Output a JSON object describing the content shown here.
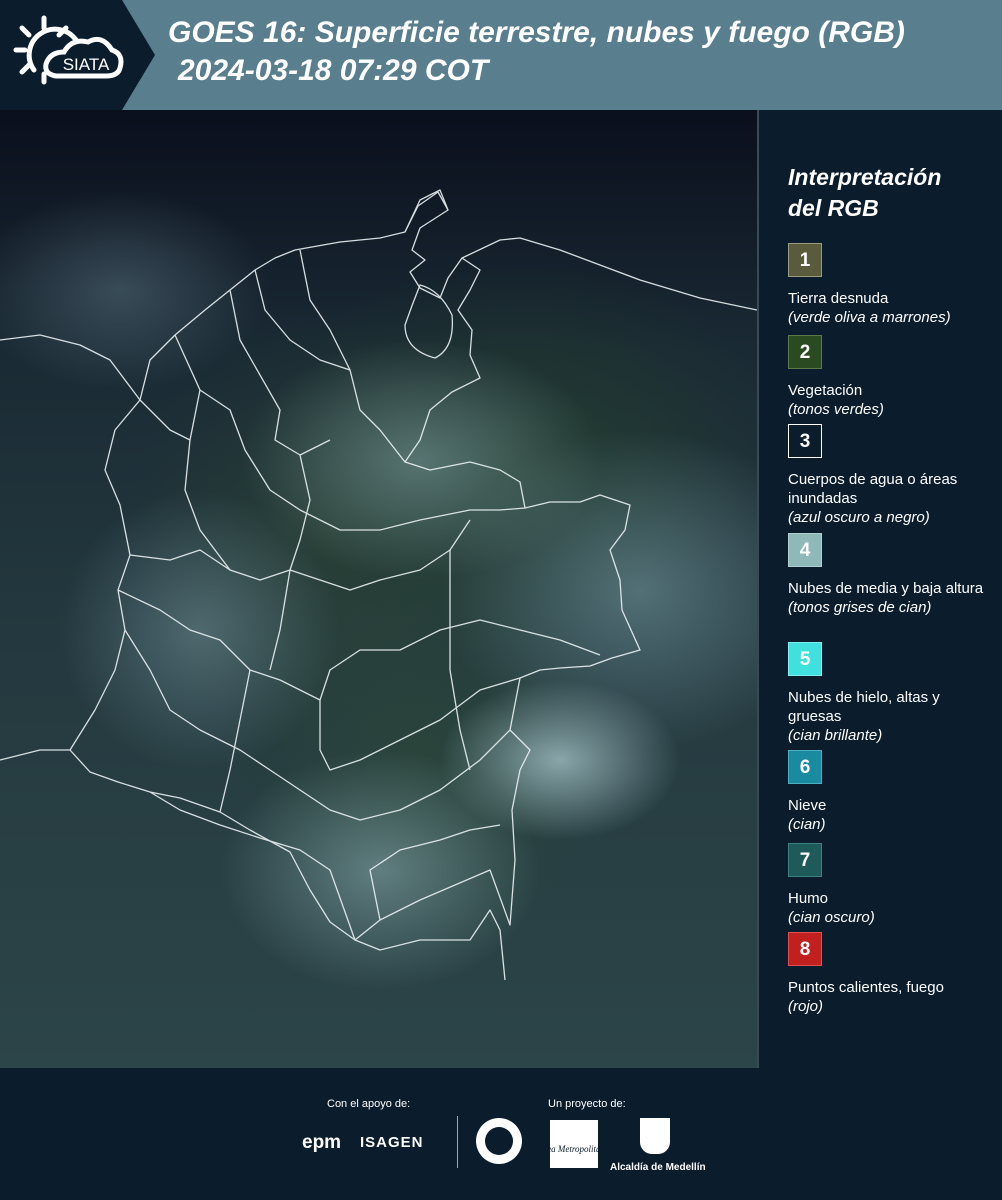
{
  "header": {
    "logo_text": "SIATA",
    "title_line1": "GOES 16: Superficie terrestre, nubes y fuego (RGB)",
    "title_line2": "2024-03-18 07:29 COT"
  },
  "legend": {
    "title_line1": "Interpretación",
    "title_line2": "del RGB",
    "items": [
      {
        "number": "1",
        "color": "#5a5a3c",
        "desc": "Tierra desnuda",
        "note": "(verde oliva a marrones)"
      },
      {
        "number": "2",
        "color": "#2a4a22",
        "desc": "Vegetación",
        "note": "(tonos verdes)"
      },
      {
        "number": "3",
        "color": "#0b1c2c",
        "desc": "Cuerpos de agua o áreas inundadas",
        "note": "(azul oscuro a negro)"
      },
      {
        "number": "4",
        "color": "#8fb8b8",
        "desc": "Nubes de media y baja altura",
        "note": "(tonos grises de cian)"
      },
      {
        "number": "5",
        "color": "#3fe0de",
        "desc": "Nubes de hielo, altas y gruesas",
        "note": "(cian brillante)"
      },
      {
        "number": "6",
        "color": "#1a8aa0",
        "desc": "Nieve",
        "note": "(cian)"
      },
      {
        "number": "7",
        "color": "#1f5a5a",
        "desc": "Humo",
        "note": "(cian oscuro)"
      },
      {
        "number": "8",
        "color": "#c21f1f",
        "desc": "Puntos calientes, fuego",
        "note": "(rojo)"
      }
    ]
  },
  "footer": {
    "support_label": "Con el apoyo de:",
    "project_label": "Un proyecto de:",
    "sponsor1": "epm",
    "sponsor2": "ISAGEN",
    "partner1": "Área Metropolitana",
    "partner2": "Alcaldía de Medellín"
  }
}
